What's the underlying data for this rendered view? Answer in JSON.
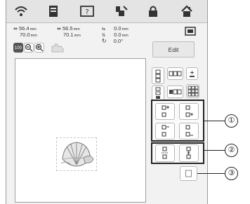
{
  "status": {
    "width_value": "56.4",
    "width_unit": "mm",
    "height_value": "70.0",
    "height_unit": "mm",
    "size2_w_value": "56.5",
    "size2_w_unit": "mm",
    "size2_h_value": "70.1",
    "size2_h_unit": "mm",
    "offset_x_value": "0.0",
    "offset_x_unit": "mm",
    "offset_y_value": "0.0",
    "offset_y_unit": "mm",
    "angle_value": "0.0°"
  },
  "toolbar": {
    "zoom_level": "100",
    "edit_label": "Edit"
  },
  "callouts": [
    "①",
    "②",
    "③"
  ],
  "icons": {
    "top": [
      "wifi-icon",
      "embroidery-settings-icon",
      "help-icon",
      "thread-icon",
      "lock-icon",
      "home-icon"
    ],
    "zoom": [
      "zoom-level-icon",
      "zoom-out-icon",
      "zoom-in-icon",
      "hand-scroll-icon"
    ]
  }
}
